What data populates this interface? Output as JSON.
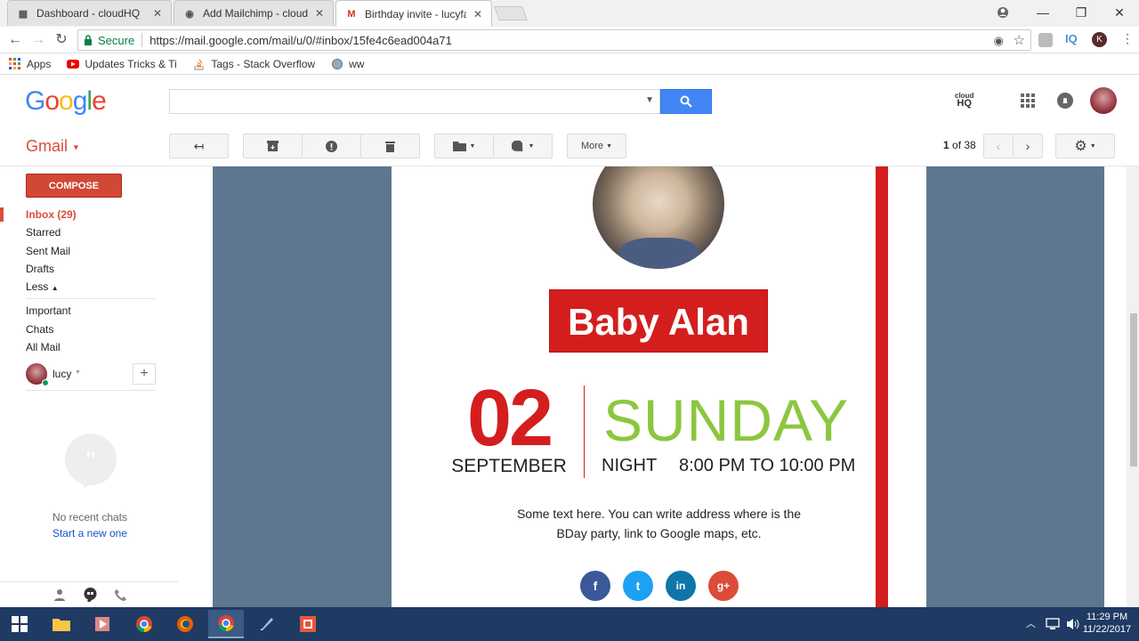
{
  "browser": {
    "tabs": [
      {
        "label": "Dashboard - cloudHQ",
        "icon": "cloudhq-icon"
      },
      {
        "label": "Add Mailchimp - cloudH",
        "icon": "mailchimp-icon"
      },
      {
        "label": "Birthday invite - lucyfara",
        "icon": "gmail-icon"
      }
    ],
    "secure_label": "Secure",
    "url": "https://mail.google.com/mail/u/0/#inbox/15fe4c6ead004a71",
    "bookmarks": [
      {
        "label": "Apps",
        "icon": "apps-grid-icon"
      },
      {
        "label": "Updates Tricks & Tips",
        "icon": "youtube-icon"
      },
      {
        "label": "Tags - Stack Overflow",
        "icon": "stackoverflow-icon"
      },
      {
        "label": "ww",
        "icon": "globe-icon"
      }
    ]
  },
  "gmail": {
    "logo": "Google",
    "app_label": "Gmail",
    "more_label": "More",
    "pagination": {
      "current": "1",
      "of_text": "of 38"
    },
    "compose_label": "COMPOSE",
    "nav": {
      "inbox": "Inbox (29)",
      "starred": "Starred",
      "sent": "Sent Mail",
      "drafts": "Drafts",
      "less": "Less",
      "important": "Important",
      "chats": "Chats",
      "all_mail": "All Mail"
    },
    "user_name": "lucy",
    "no_chats": "No recent chats",
    "start_new": "Start a new one",
    "cloudhq_label_top": "cloud",
    "cloudhq_label_bottom": "HQ"
  },
  "email": {
    "name": "Baby Alan",
    "day_number": "02",
    "month": "SEPTEMBER",
    "weekday": "SUNDAY",
    "time_prefix": "NIGHT",
    "time_range": "8:00 PM TO 10:00 PM",
    "body_line1": "Some text here. You can write address where is the",
    "body_line2": "BDay party, link to Google maps, etc.",
    "social": [
      {
        "name": "facebook",
        "glyph": "f",
        "color": "#3b5998"
      },
      {
        "name": "twitter",
        "glyph": "t",
        "color": "#1da1f2"
      },
      {
        "name": "linkedin",
        "glyph": "in",
        "color": "#0e76a8"
      },
      {
        "name": "google-plus",
        "glyph": "g+",
        "color": "#dd4b39"
      }
    ]
  },
  "taskbar": {
    "time": "11:29 PM",
    "date": "11/22/2017"
  },
  "colors": {
    "email_red": "#d41e1e",
    "weekday_green": "#8dc63f",
    "backdrop_slate": "#5d7790",
    "gmail_red": "#dd4b39"
  }
}
